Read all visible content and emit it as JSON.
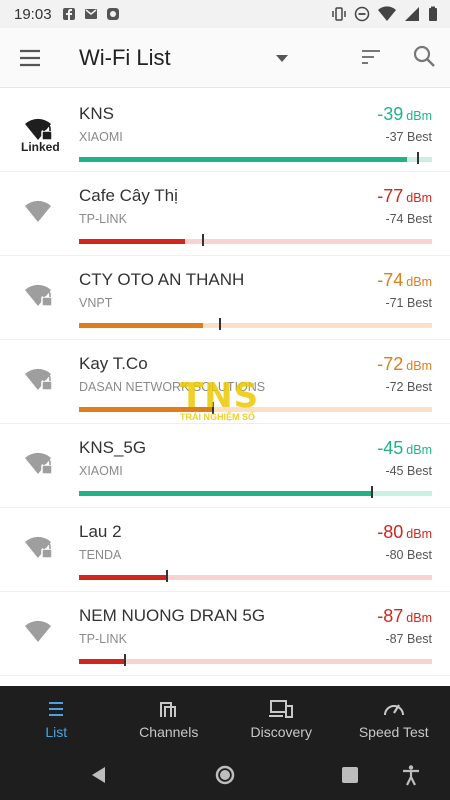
{
  "status_bar": {
    "time": "19:03"
  },
  "app_bar": {
    "title": "Wi-Fi List"
  },
  "colors": {
    "green": "#20b38a",
    "red": "#d0261c",
    "orange": "#df7d1a",
    "nav_active": "#4aa3df"
  },
  "networks": [
    {
      "ssid": "KNS",
      "vendor": "XIAOMI",
      "signal": "-39",
      "unit": "dBm",
      "best": "-37 Best",
      "linked": "Linked",
      "locked": true,
      "level": 0.93,
      "best_level": 0.96,
      "color": "green"
    },
    {
      "ssid": "Cafe Cây Thị",
      "vendor": "TP-LINK",
      "signal": "-77",
      "unit": "dBm",
      "best": "-74 Best",
      "locked": false,
      "level": 0.3,
      "best_level": 0.35,
      "color": "red"
    },
    {
      "ssid": "CTY OTO AN THANH",
      "vendor": "VNPT",
      "signal": "-74",
      "unit": "dBm",
      "best": "-71 Best",
      "locked": true,
      "level": 0.35,
      "best_level": 0.4,
      "color": "orange"
    },
    {
      "ssid": "Kay T.Co",
      "vendor": "DASAN NETWORK SOLUTIONS",
      "signal": "-72",
      "unit": "dBm",
      "best": "-72 Best",
      "locked": true,
      "level": 0.38,
      "best_level": 0.38,
      "color": "orange"
    },
    {
      "ssid": "KNS_5G",
      "vendor": "XIAOMI",
      "signal": "-45",
      "unit": "dBm",
      "best": "-45 Best",
      "locked": true,
      "level": 0.83,
      "best_level": 0.83,
      "color": "green"
    },
    {
      "ssid": "Lau 2",
      "vendor": "TENDA",
      "signal": "-80",
      "unit": "dBm",
      "best": "-80 Best",
      "locked": true,
      "level": 0.25,
      "best_level": 0.25,
      "color": "red"
    },
    {
      "ssid": "NEM NUONG DRAN 5G",
      "vendor": "TP-LINK",
      "signal": "-87",
      "unit": "dBm",
      "best": "-87 Best",
      "locked": false,
      "level": 0.13,
      "best_level": 0.13,
      "color": "red"
    }
  ],
  "watermark": {
    "text": "TNS",
    "sub": "TRẢI NGHIỆM SỐ"
  },
  "bottom_nav": [
    {
      "label": "List",
      "icon": "list-icon",
      "active": true
    },
    {
      "label": "Channels",
      "icon": "channels-icon",
      "active": false
    },
    {
      "label": "Discovery",
      "icon": "devices-icon",
      "active": false
    },
    {
      "label": "Speed Test",
      "icon": "speedometer-icon",
      "active": false
    }
  ]
}
